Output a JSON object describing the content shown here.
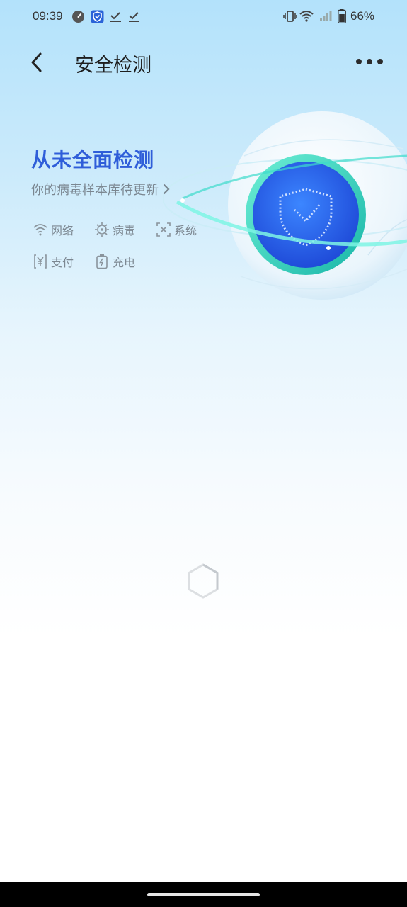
{
  "status_bar": {
    "time": "09:39",
    "battery": "66%"
  },
  "app_bar": {
    "title": "安全检测",
    "back_icon": "chevron-left-icon",
    "more_icon": "more-horizontal-icon"
  },
  "summary": {
    "headline": "从未全面检测",
    "subline": "你的病毒样本库待更新"
  },
  "check_items": [
    {
      "label": "网络",
      "icon": "wifi-icon"
    },
    {
      "label": "病毒",
      "icon": "virus-icon"
    },
    {
      "label": "系统",
      "icon": "system-icon"
    },
    {
      "label": "支付",
      "icon": "payment-icon"
    },
    {
      "label": "充电",
      "icon": "charging-icon"
    }
  ],
  "colors": {
    "accent": "#2f5ed9",
    "shield_blue": "#2a6cf0",
    "ring_teal": "#3ed6c4"
  }
}
